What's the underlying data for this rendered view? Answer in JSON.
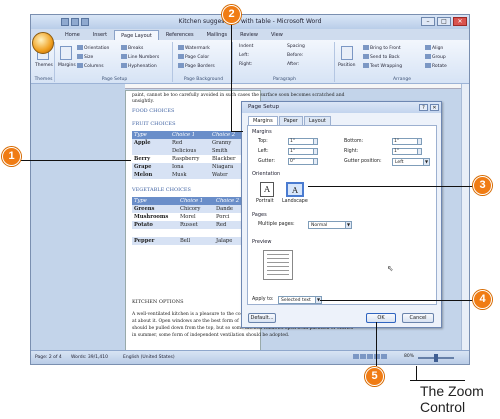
{
  "window": {
    "title": "Kitchen suggestions with table - Microsoft Word",
    "min": "–",
    "max": "□",
    "close": "✕"
  },
  "ribbon": {
    "tabs": [
      "Home",
      "Insert",
      "Page Layout",
      "References",
      "Mailings",
      "Review",
      "View"
    ],
    "groups": {
      "themes": {
        "label": "Themes",
        "item": "Themes"
      },
      "page_setup": {
        "label": "Page Setup",
        "items": [
          "Orientation",
          "Size",
          "Columns",
          "Margins",
          "Breaks",
          "Line Numbers",
          "Hyphenation"
        ]
      },
      "page_background": {
        "label": "Page Background",
        "items": [
          "Watermark",
          "Page Color",
          "Page Borders"
        ]
      },
      "paragraph": {
        "label": "Paragraph",
        "indent": "Indent",
        "spacing": "Spacing",
        "left": "Left:",
        "right": "Right:",
        "before": "Before:",
        "after": "After:"
      },
      "arrange": {
        "label": "Arrange",
        "items": [
          "Position",
          "Bring to Front",
          "Send to Back",
          "Text Wrapping",
          "Align",
          "Group",
          "Rotate"
        ]
      }
    }
  },
  "document": {
    "top_text": [
      "paint, cannot be too carefully avoided in such cases the surface soon becomes scratched and",
      "unsightly."
    ],
    "food_heading": "FOOD CHOICES",
    "fruit_heading": "FRUIT CHOICES",
    "fruit_table": {
      "header": [
        "Type",
        "Choice 1",
        "Choice 2"
      ],
      "rows": [
        [
          "Apple",
          "Red",
          "Granny"
        ],
        [
          "",
          "Delicious",
          "Smith"
        ],
        [
          "Berry",
          "Raspberry",
          "Blackber"
        ],
        [
          "Grape",
          "Iona",
          "Niagara"
        ],
        [
          "Melon",
          "Musk",
          "Water"
        ]
      ]
    },
    "veg_heading": "VEGETABLE CHOICES",
    "veg_table": {
      "header": [
        "Type",
        "Choice 1",
        "Choice 2"
      ],
      "rows": [
        [
          "Greens",
          "Chicory",
          "Dande"
        ],
        [
          "Mushrooms",
          "Morel",
          "Porci"
        ],
        [
          "Potato",
          "Russet",
          "Red"
        ],
        [
          "",
          "",
          " "
        ],
        [
          "Pepper",
          "Bell",
          "Jalape"
        ]
      ]
    },
    "options_heading": "KITCHEN OPTIONS",
    "body_lines": [
      "A well-ventilated kitchen is a pleasure to the cook and",
      "at about it. Open windows are the best form of",
      "should be pulled down from the top, but so some kitchen windows open from partition or entries",
      "in summer, some form of independent ventilation should be adopted."
    ]
  },
  "status_bar": {
    "page": "Page: 2 of 4",
    "words": "Words: 39/1,410",
    "language": "English (United States)",
    "zoom": "80%",
    "zoom_level": 0.8
  },
  "dialog": {
    "title": "Page Setup",
    "tabs": [
      "Margins",
      "Paper",
      "Layout"
    ],
    "margins_section": "Margins",
    "top": {
      "label": "Top:",
      "value": "1\""
    },
    "bottom": {
      "label": "Bottom:",
      "value": "1\""
    },
    "left": {
      "label": "Left:",
      "value": "1\""
    },
    "right": {
      "label": "Right:",
      "value": "1\""
    },
    "gutter": {
      "label": "Gutter:",
      "value": "0\""
    },
    "gutter_position": {
      "label": "Gutter position:",
      "value": "Left"
    },
    "orientation_section": "Orientation",
    "portrait": "Portrait",
    "landscape": "Landscape",
    "pages_section": "Pages",
    "multiple_pages": {
      "label": "Multiple pages:",
      "value": "Normal"
    },
    "preview_section": "Preview",
    "apply_to": {
      "label": "Apply to:",
      "value": "Selected text"
    },
    "default_btn": "Default...",
    "ok_btn": "OK",
    "cancel_btn": "Cancel",
    "help": "?",
    "close": "✕"
  },
  "callouts": [
    "1",
    "2",
    "3",
    "4",
    "5"
  ],
  "caption": {
    "line1": "The Zoom",
    "line2": "Control"
  }
}
